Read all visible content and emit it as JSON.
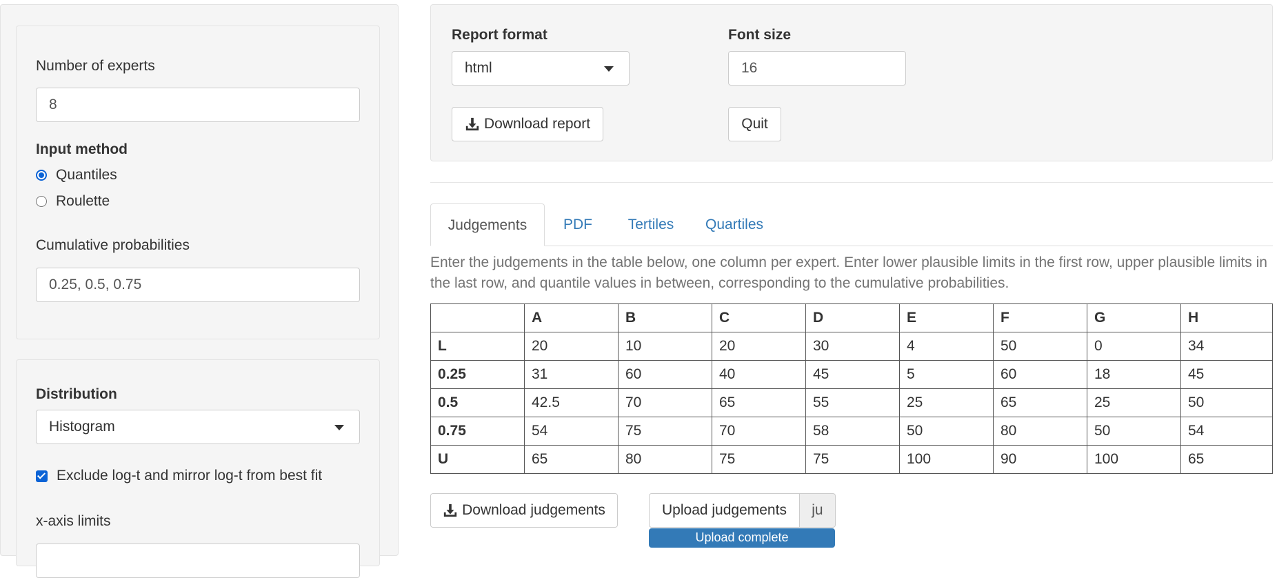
{
  "sidebar": {
    "num_experts_label": "Number of experts",
    "num_experts_value": "8",
    "input_method_label": "Input method",
    "input_methods": [
      "Quantiles",
      "Roulette"
    ],
    "input_method_selected": "Quantiles",
    "cumprob_label": "Cumulative probabilities",
    "cumprob_value": "0.25, 0.5, 0.75",
    "distribution_label": "Distribution",
    "distribution_value": "Histogram",
    "exclude_label": "Exclude log-t and mirror log-t from best fit",
    "exclude_checked": true,
    "xaxis_label": "x-axis limits"
  },
  "report": {
    "format_label": "Report format",
    "format_value": "html",
    "font_label": "Font size",
    "font_value": "16",
    "download_report": "Download report",
    "quit": "Quit"
  },
  "tabs": [
    {
      "label": "Judgements",
      "active": true
    },
    {
      "label": "PDF",
      "active": false
    },
    {
      "label": "Tertiles",
      "active": false
    },
    {
      "label": "Quartiles",
      "active": false
    }
  ],
  "help_text": "Enter the judgements in the table below, one column per expert. Enter lower plausible limits in the first row, upper plausible limits in the last row, and quantile values in between, corresponding to the cumulative probabilities.",
  "table": {
    "columns": [
      "",
      "A",
      "B",
      "C",
      "D",
      "E",
      "F",
      "G",
      "H"
    ],
    "rows": [
      [
        "L",
        "20",
        "10",
        "20",
        "30",
        "4",
        "50",
        "0",
        "34"
      ],
      [
        "0.25",
        "31",
        "60",
        "40",
        "45",
        "5",
        "60",
        "18",
        "45"
      ],
      [
        "0.5",
        "42.5",
        "70",
        "65",
        "55",
        "25",
        "65",
        "25",
        "50"
      ],
      [
        "0.75",
        "54",
        "75",
        "70",
        "58",
        "50",
        "80",
        "50",
        "54"
      ],
      [
        "U",
        "65",
        "80",
        "75",
        "75",
        "100",
        "90",
        "100",
        "65"
      ]
    ]
  },
  "buttons": {
    "download_judgements": "Download judgements",
    "upload_judgements": "Upload judgements",
    "upload_filename": "ju",
    "upload_status": "Upload complete"
  },
  "colors": {
    "link": "#337ab7",
    "accent": "#0b63d6",
    "well_bg": "#f5f5f5"
  }
}
